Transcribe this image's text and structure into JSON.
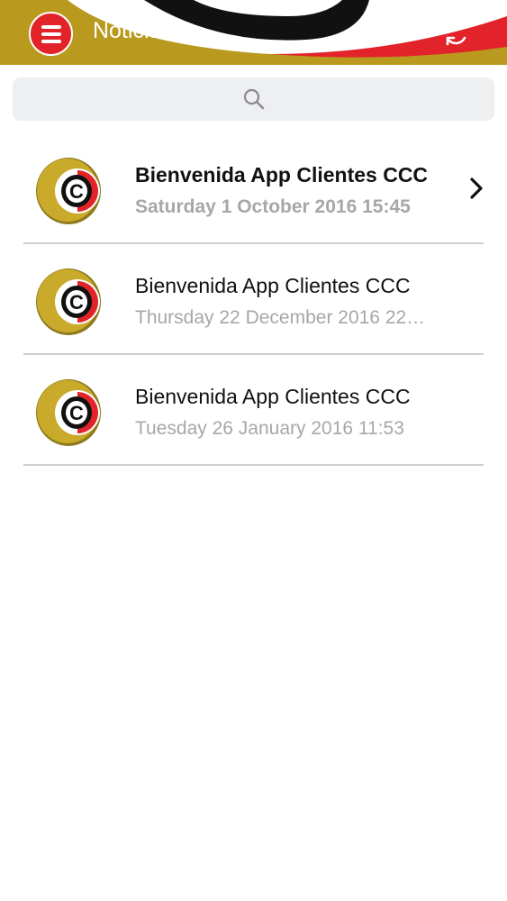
{
  "header": {
    "title": "Noticias",
    "menu_icon": "hamburger-menu-icon",
    "refresh_icon": "refresh-icon"
  },
  "search": {
    "icon": "search-icon"
  },
  "news": [
    {
      "title": "Bienvenida App Clientes CCC",
      "date": "Saturday 1 October 2016 15:45",
      "selected": true
    },
    {
      "title": "Bienvenida App Clientes CCC",
      "date": "Thursday 22 December 2016 22…",
      "selected": false
    },
    {
      "title": "Bienvenida App Clientes CCC",
      "date": "Tuesday 26 January 2016 11:53",
      "selected": false
    }
  ],
  "colors": {
    "header_gold": "#b99a1e",
    "brand_red": "#e2232a",
    "date_gray": "#a7a7a7"
  }
}
